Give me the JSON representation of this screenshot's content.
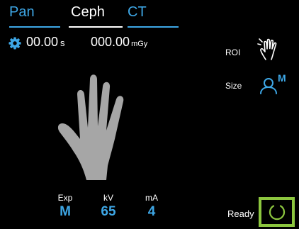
{
  "tabs": [
    {
      "label": "Pan",
      "state": "inactive"
    },
    {
      "label": "Ceph",
      "state": "active"
    },
    {
      "label": "CT",
      "state": "inactive"
    }
  ],
  "status": {
    "time_value": "00.00",
    "time_unit": "s",
    "dose_value": "000.00",
    "dose_unit": "mGy"
  },
  "side": {
    "roi_label": "ROI",
    "size_label": "Size",
    "size_badge": "M"
  },
  "params": [
    {
      "label": "Exp",
      "value": "M"
    },
    {
      "label": "kV",
      "value": "65"
    },
    {
      "label": "mA",
      "value": "4"
    }
  ],
  "ready": {
    "label": "Ready"
  },
  "colors": {
    "accent_blue": "#3ea7e6",
    "ready_green": "#8cc63f",
    "background": "#000000",
    "hand_gray": "#a6a6a6"
  },
  "icons": {
    "settings": "gear-icon",
    "roi": "hand-roi-icon",
    "size": "person-size-icon",
    "subject": "hand-icon",
    "ready": "ready-ring-icon"
  }
}
